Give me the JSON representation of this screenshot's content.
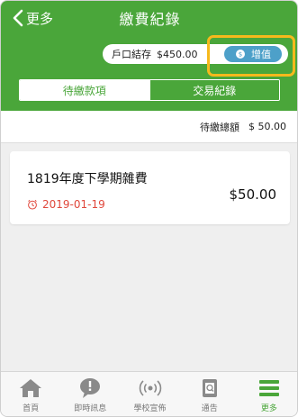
{
  "header": {
    "back_label": "更多",
    "title": "繳費紀錄"
  },
  "balance": {
    "label": "戶口結存",
    "value": "$450.00",
    "topup_label": "增值"
  },
  "tabs": [
    {
      "label": "待繳款項",
      "active": true
    },
    {
      "label": "交易紀錄",
      "active": false
    }
  ],
  "summary": {
    "label": "待繳總額",
    "value": "$ 50.00"
  },
  "items": [
    {
      "name": "1819年度下學期雜費",
      "date": "2019-01-19",
      "amount": "$50.00"
    }
  ],
  "bottom_nav": [
    {
      "label": "首頁",
      "icon": "home-icon"
    },
    {
      "label": "即時訊息",
      "icon": "message-icon"
    },
    {
      "label": "學校宣佈",
      "icon": "broadcast-icon"
    },
    {
      "label": "通告",
      "icon": "notice-icon"
    },
    {
      "label": "更多",
      "icon": "menu-icon",
      "active": true
    }
  ],
  "colors": {
    "primary": "#4aa63a",
    "topup": "#4da0c9",
    "highlight": "#f6b91c",
    "date": "#e0483c"
  }
}
